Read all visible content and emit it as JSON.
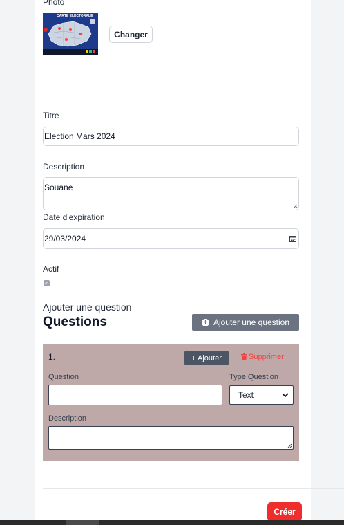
{
  "photo": {
    "label": "Photo",
    "thumb_caption": "CARTE ELECTORALE",
    "change_button": "Changer"
  },
  "form": {
    "titre_label": "Titre",
    "titre_value": "Election Mars 2024",
    "description_label": "Description",
    "description_value": "Souane",
    "date_label": "Date d'expiration",
    "date_value": "29/03/2024",
    "actif_label": "Actif",
    "actif_checked": true
  },
  "questions_section": {
    "add_text": "Ajouter une question",
    "heading": "Questions",
    "add_button": "Ajouter une question",
    "card": {
      "number": "1.",
      "add_button": "+ Ajouter",
      "delete_button": "Supprimer",
      "question_label": "Question",
      "type_label": "Type Question",
      "type_value": "Text",
      "description_label": "Description"
    }
  },
  "submit_button": "Créer",
  "colors": {
    "card_bg": "#bfa8a8",
    "danger": "#ef2d2d",
    "secondary": "#6b7280"
  }
}
